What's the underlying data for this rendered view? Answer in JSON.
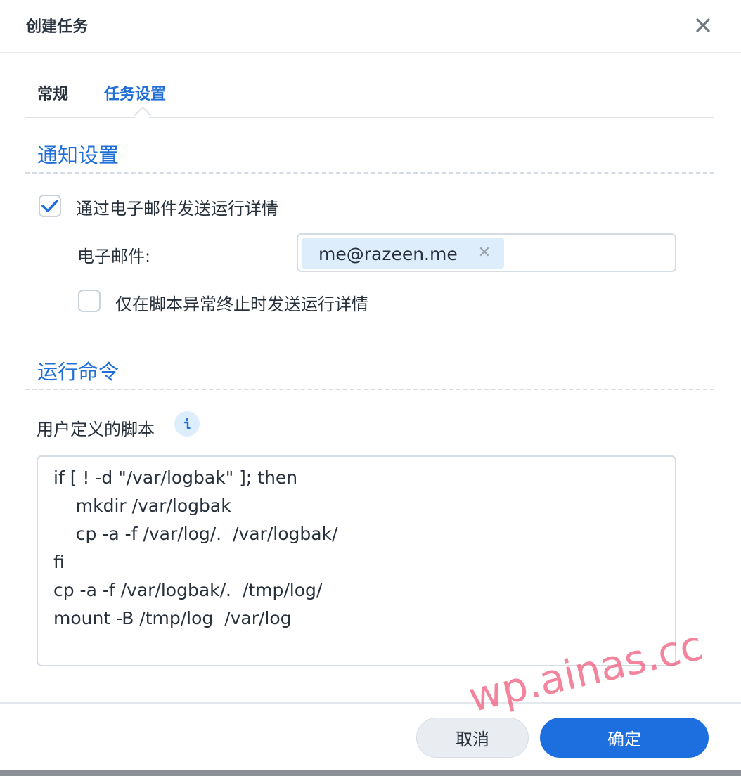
{
  "dialog": {
    "title": "创建任务",
    "close_icon": "close-icon"
  },
  "tabs": [
    {
      "label": "常规",
      "active": false
    },
    {
      "label": "任务设置",
      "active": true
    }
  ],
  "notification": {
    "section_title": "通知设置",
    "send_email_label": "通过电子邮件发送运行详情",
    "send_email_checked": true,
    "email_label": "电子邮件:",
    "email_chip": "me@razeen.me",
    "only_on_error_label": "仅在脚本异常终止时发送运行详情",
    "only_on_error_checked": false
  },
  "command": {
    "section_title": "运行命令",
    "script_label": "用户定义的脚本",
    "info_icon": "info-icon",
    "script_lines": [
      "if [ ! -d \"/var/logbak\" ]; then",
      "    mkdir /var/logbak",
      "    cp -a -f /var/log/.  /var/logbak/",
      "fi",
      "cp -a -f /var/logbak/.  /tmp/log/",
      "mount -B /tmp/log  /var/log"
    ]
  },
  "footer": {
    "cancel_label": "取消",
    "ok_label": "确定"
  },
  "watermark": "wp.ainas.cc",
  "colors": {
    "accent": "#1d6fe0",
    "section_title": "#1f6fd6",
    "chip_bg": "#deedfc"
  }
}
